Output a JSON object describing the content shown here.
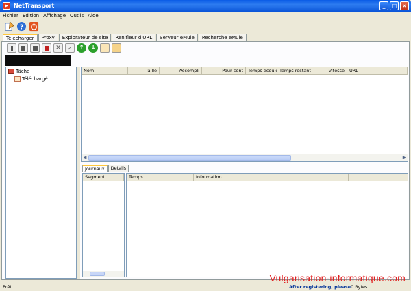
{
  "window": {
    "title": "NetTransport"
  },
  "menu": [
    "Fichier",
    "Edition",
    "Affichage",
    "Outils",
    "Aide"
  ],
  "main_toolbar": {
    "icons": [
      "new-task-icon",
      "help-icon",
      "power-icon"
    ]
  },
  "tabs": [
    "Télécharger",
    "Proxy",
    "Explorateur de site",
    "Renifleur d'URL",
    "Serveur eMule",
    "Recherche eMule"
  ],
  "task_toolbar": {
    "icons": [
      "start-icon",
      "pause-icon",
      "stop-icon",
      "schedule-icon",
      "delete-icon",
      "properties-icon",
      "move-up-icon",
      "move-down-icon",
      "open-file-icon",
      "open-folder-icon"
    ]
  },
  "tree": {
    "root": "Tâche",
    "child": "Téléchargé"
  },
  "task_columns": [
    "Nom",
    "Taille",
    "Accompli",
    "Pour cent",
    "Temps écoulé",
    "Temps restant",
    "Vitesse",
    "URL"
  ],
  "bottom_tabs": [
    "Journaux",
    "Details"
  ],
  "segment_header": "Segment",
  "log_columns": [
    "Temps",
    "Information"
  ],
  "status": {
    "left": "Prêt",
    "registration": "After registering, please",
    "bytes": "0 Bytes"
  },
  "watermark": "Vulgarisation-informatique.com",
  "colors": {
    "accent": "#0a5ce6",
    "watermark": "#e02020",
    "tab_highlight": "#ffc83c"
  }
}
